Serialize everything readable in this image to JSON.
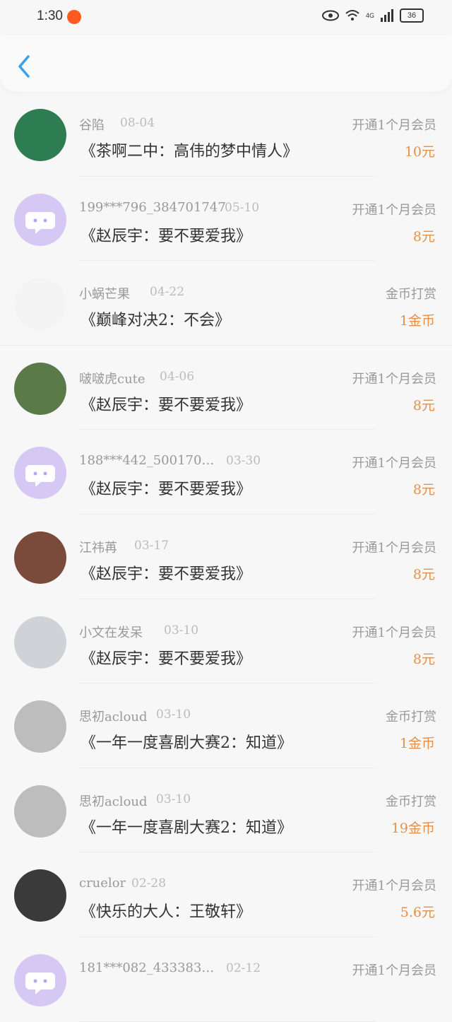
{
  "status": {
    "time": "1:30",
    "battery": "36",
    "network": "4G"
  },
  "rows": [
    {
      "name": "谷陷",
      "date": "08-04",
      "book": "《茶啊二中：高伟的梦中情人》",
      "type": "开通1个月会员",
      "amount": "10元",
      "avatar_color": "#2e7d52"
    },
    {
      "name": "199***796_384701747",
      "date": "05-10",
      "book": "《赵辰宇：要不要爱我》",
      "type": "开通1个月会员",
      "amount": "8元",
      "avatar_color": "#d6c8f5"
    },
    {
      "name": "小蜗芒果",
      "date": "04-22",
      "book": "《巅峰对决2：不会》",
      "type": "金币打赏",
      "amount": "1金币",
      "avatar_color": "#f4f4f4"
    },
    {
      "name": "啵啵虎cute",
      "date": "04-06",
      "book": "《赵辰宇：要不要爱我》",
      "type": "开通1个月会员",
      "amount": "8元",
      "avatar_color": "#5a7a4a"
    },
    {
      "name": "188***442_500170…",
      "date": "03-30",
      "book": "《赵辰宇：要不要爱我》",
      "type": "开通1个月会员",
      "amount": "8元",
      "avatar_color": "#d6c8f5"
    },
    {
      "name": "江祎苒",
      "date": "03-17",
      "book": "《赵辰宇：要不要爱我》",
      "type": "开通1个月会员",
      "amount": "8元",
      "avatar_color": "#7a4a3a"
    },
    {
      "name": "小文在发呆",
      "date": "03-10",
      "book": "《赵辰宇：要不要爱我》",
      "type": "开通1个月会员",
      "amount": "8元",
      "avatar_color": "#cfd3d8"
    },
    {
      "name": "思初acloud",
      "date": "03-10",
      "book": "《一年一度喜剧大赛2：知道》",
      "type": "金币打赏",
      "amount": "1金币",
      "avatar_color": "#bdbdbd"
    },
    {
      "name": "思初acloud",
      "date": "03-10",
      "book": "《一年一度喜剧大赛2：知道》",
      "type": "金币打赏",
      "amount": "19金币",
      "avatar_color": "#bdbdbd"
    },
    {
      "name": "cruelor",
      "date": "02-28",
      "book": "《快乐的大人：王敬轩》",
      "type": "开通1个月会员",
      "amount": "5.6元",
      "avatar_color": "#3a3a3a"
    },
    {
      "name": "181***082_433383…",
      "date": "02-12",
      "book": "",
      "type": "开通1个月会员",
      "amount": "",
      "avatar_color": "#d6c8f5"
    }
  ]
}
